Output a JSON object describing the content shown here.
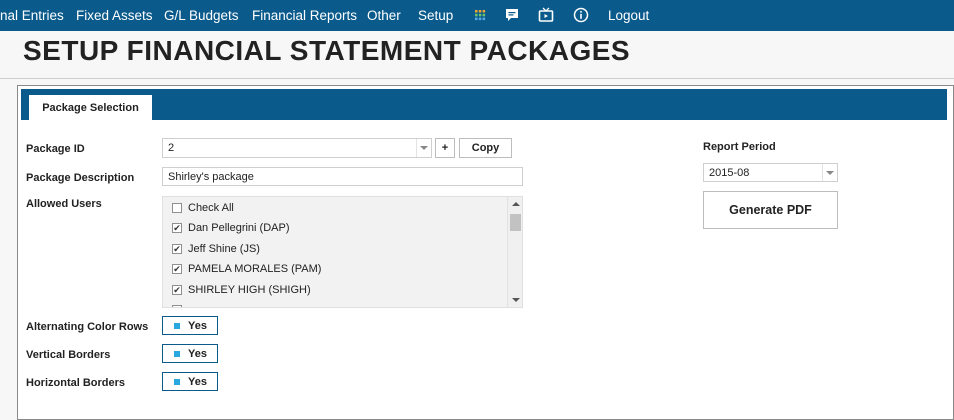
{
  "nav": {
    "items": [
      "nal Entries",
      "Fixed Assets",
      "G/L Budgets",
      "Financial Reports",
      "Other",
      "Setup",
      "Logout"
    ],
    "icons": [
      "grid-icon",
      "chat-icon",
      "tv-icon",
      "info-icon"
    ]
  },
  "page": {
    "title": "SETUP FINANCIAL STATEMENT PACKAGES"
  },
  "tabs": {
    "active": "Package Selection"
  },
  "form": {
    "package_id_label": "Package ID",
    "package_id_value": "2",
    "add_label": "+",
    "copy_label": "Copy",
    "description_label": "Package Description",
    "description_value": "Shirley's package",
    "allowed_users_label": "Allowed Users",
    "users": [
      {
        "label": "Check All",
        "checked": false
      },
      {
        "label": "Dan Pellegrini (DAP)",
        "checked": true
      },
      {
        "label": "Jeff Shine (JS)",
        "checked": true
      },
      {
        "label": "PAMELA MORALES (PAM)",
        "checked": true
      },
      {
        "label": "SHIRLEY HIGH (SHIGH)",
        "checked": true
      }
    ],
    "alternating_label": "Alternating Color Rows",
    "alternating_value": "Yes",
    "vertical_label": "Vertical Borders",
    "vertical_value": "Yes",
    "horizontal_label": "Horizontal Borders",
    "horizontal_value": "Yes"
  },
  "report": {
    "period_label": "Report Period",
    "period_value": "2015-08",
    "generate_label": "Generate PDF"
  },
  "colors": {
    "nav_bg": "#0a5a8c",
    "toggle_dot": "#29a8e0"
  }
}
